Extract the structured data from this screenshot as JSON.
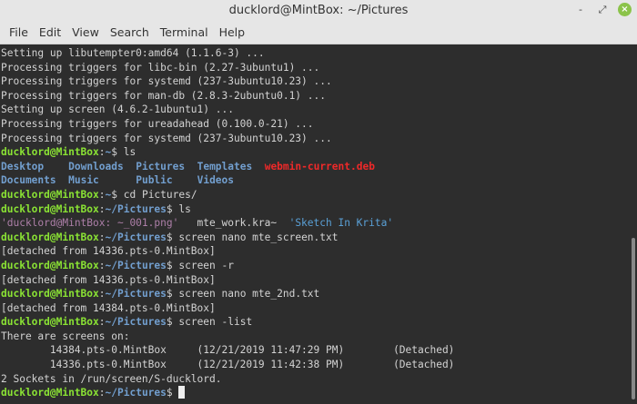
{
  "window": {
    "title": "ducklord@MintBox: ~/Pictures",
    "buttons": [
      "-",
      "⤢",
      "×"
    ]
  },
  "menu": [
    "File",
    "Edit",
    "View",
    "Search",
    "Terminal",
    "Help"
  ],
  "colors": {
    "background": "#2d2d2d",
    "prompt": "#8ae234",
    "path": "#729fcf",
    "archive": "#ef2929"
  },
  "terminal": {
    "lines": [
      [
        [
          "",
          "Setting up libutempter0:amd64 (1.1.6-3) ..."
        ]
      ],
      [
        [
          "",
          "Processing triggers for libc-bin (2.27-3ubuntu1) ..."
        ]
      ],
      [
        [
          "",
          "Processing triggers for systemd (237-3ubuntu10.23) ..."
        ]
      ],
      [
        [
          "",
          "Processing triggers for man-db (2.8.3-2ubuntu0.1) ..."
        ]
      ],
      [
        [
          "",
          "Setting up screen (4.6.2-1ubuntu1) ..."
        ]
      ],
      [
        [
          "",
          "Processing triggers for ureadahead (0.100.0-21) ..."
        ]
      ],
      [
        [
          "",
          "Processing triggers for systemd (237-3ubuntu10.23) ..."
        ]
      ],
      [
        [
          "g",
          "ducklord@MintBox"
        ],
        [
          "",
          ":"
        ],
        [
          "b",
          "~"
        ],
        [
          "",
          "$ ls"
        ]
      ],
      [
        [
          "b",
          "Desktop"
        ],
        [
          "",
          "    "
        ],
        [
          "b",
          "Downloads"
        ],
        [
          "",
          "  "
        ],
        [
          "b",
          "Pictures"
        ],
        [
          "",
          "  "
        ],
        [
          "b",
          "Templates"
        ],
        [
          "",
          "  "
        ],
        [
          "r",
          "webmin-current.deb"
        ]
      ],
      [
        [
          "b",
          "Documents"
        ],
        [
          "",
          "  "
        ],
        [
          "b",
          "Music"
        ],
        [
          "",
          "      "
        ],
        [
          "b",
          "Public"
        ],
        [
          "",
          "    "
        ],
        [
          "b",
          "Videos"
        ]
      ],
      [
        [
          "g",
          "ducklord@MintBox"
        ],
        [
          "",
          ":"
        ],
        [
          "b",
          "~"
        ],
        [
          "",
          "$ cd Pictures/"
        ]
      ],
      [
        [
          "g",
          "ducklord@MintBox"
        ],
        [
          "",
          ":"
        ],
        [
          "b",
          "~/Pictures"
        ],
        [
          "",
          "$ ls"
        ]
      ],
      [
        [
          "m",
          "'ducklord@MintBox: ~_001.png'"
        ],
        [
          "",
          "   mte_work.kra~  "
        ],
        [
          "q",
          "'Sketch In Krita'"
        ]
      ],
      [
        [
          "g",
          "ducklord@MintBox"
        ],
        [
          "",
          ":"
        ],
        [
          "b",
          "~/Pictures"
        ],
        [
          "",
          "$ screen nano mte_screen.txt"
        ]
      ],
      [
        [
          "",
          "[detached from 14336.pts-0.MintBox]"
        ]
      ],
      [
        [
          "g",
          "ducklord@MintBox"
        ],
        [
          "",
          ":"
        ],
        [
          "b",
          "~/Pictures"
        ],
        [
          "",
          "$ screen -r"
        ]
      ],
      [
        [
          "",
          "[detached from 14336.pts-0.MintBox]"
        ]
      ],
      [
        [
          "g",
          "ducklord@MintBox"
        ],
        [
          "",
          ":"
        ],
        [
          "b",
          "~/Pictures"
        ],
        [
          "",
          "$ screen nano mte_2nd.txt"
        ]
      ],
      [
        [
          "",
          "[detached from 14384.pts-0.MintBox]"
        ]
      ],
      [
        [
          "g",
          "ducklord@MintBox"
        ],
        [
          "",
          ":"
        ],
        [
          "b",
          "~/Pictures"
        ],
        [
          "",
          "$ screen -list"
        ]
      ],
      [
        [
          "",
          "There are screens on:"
        ]
      ],
      [
        [
          "",
          "        14384.pts-0.MintBox     (12/21/2019 11:47:29 PM)        (Detached)"
        ]
      ],
      [
        [
          "",
          "        14336.pts-0.MintBox     (12/21/2019 11:42:38 PM)        (Detached)"
        ]
      ],
      [
        [
          "",
          "2 Sockets in /run/screen/S-ducklord."
        ]
      ],
      [
        [
          "g",
          "ducklord@MintBox"
        ],
        [
          "",
          ":"
        ],
        [
          "b",
          "~/Pictures"
        ],
        [
          "",
          "$ "
        ]
      ]
    ]
  }
}
